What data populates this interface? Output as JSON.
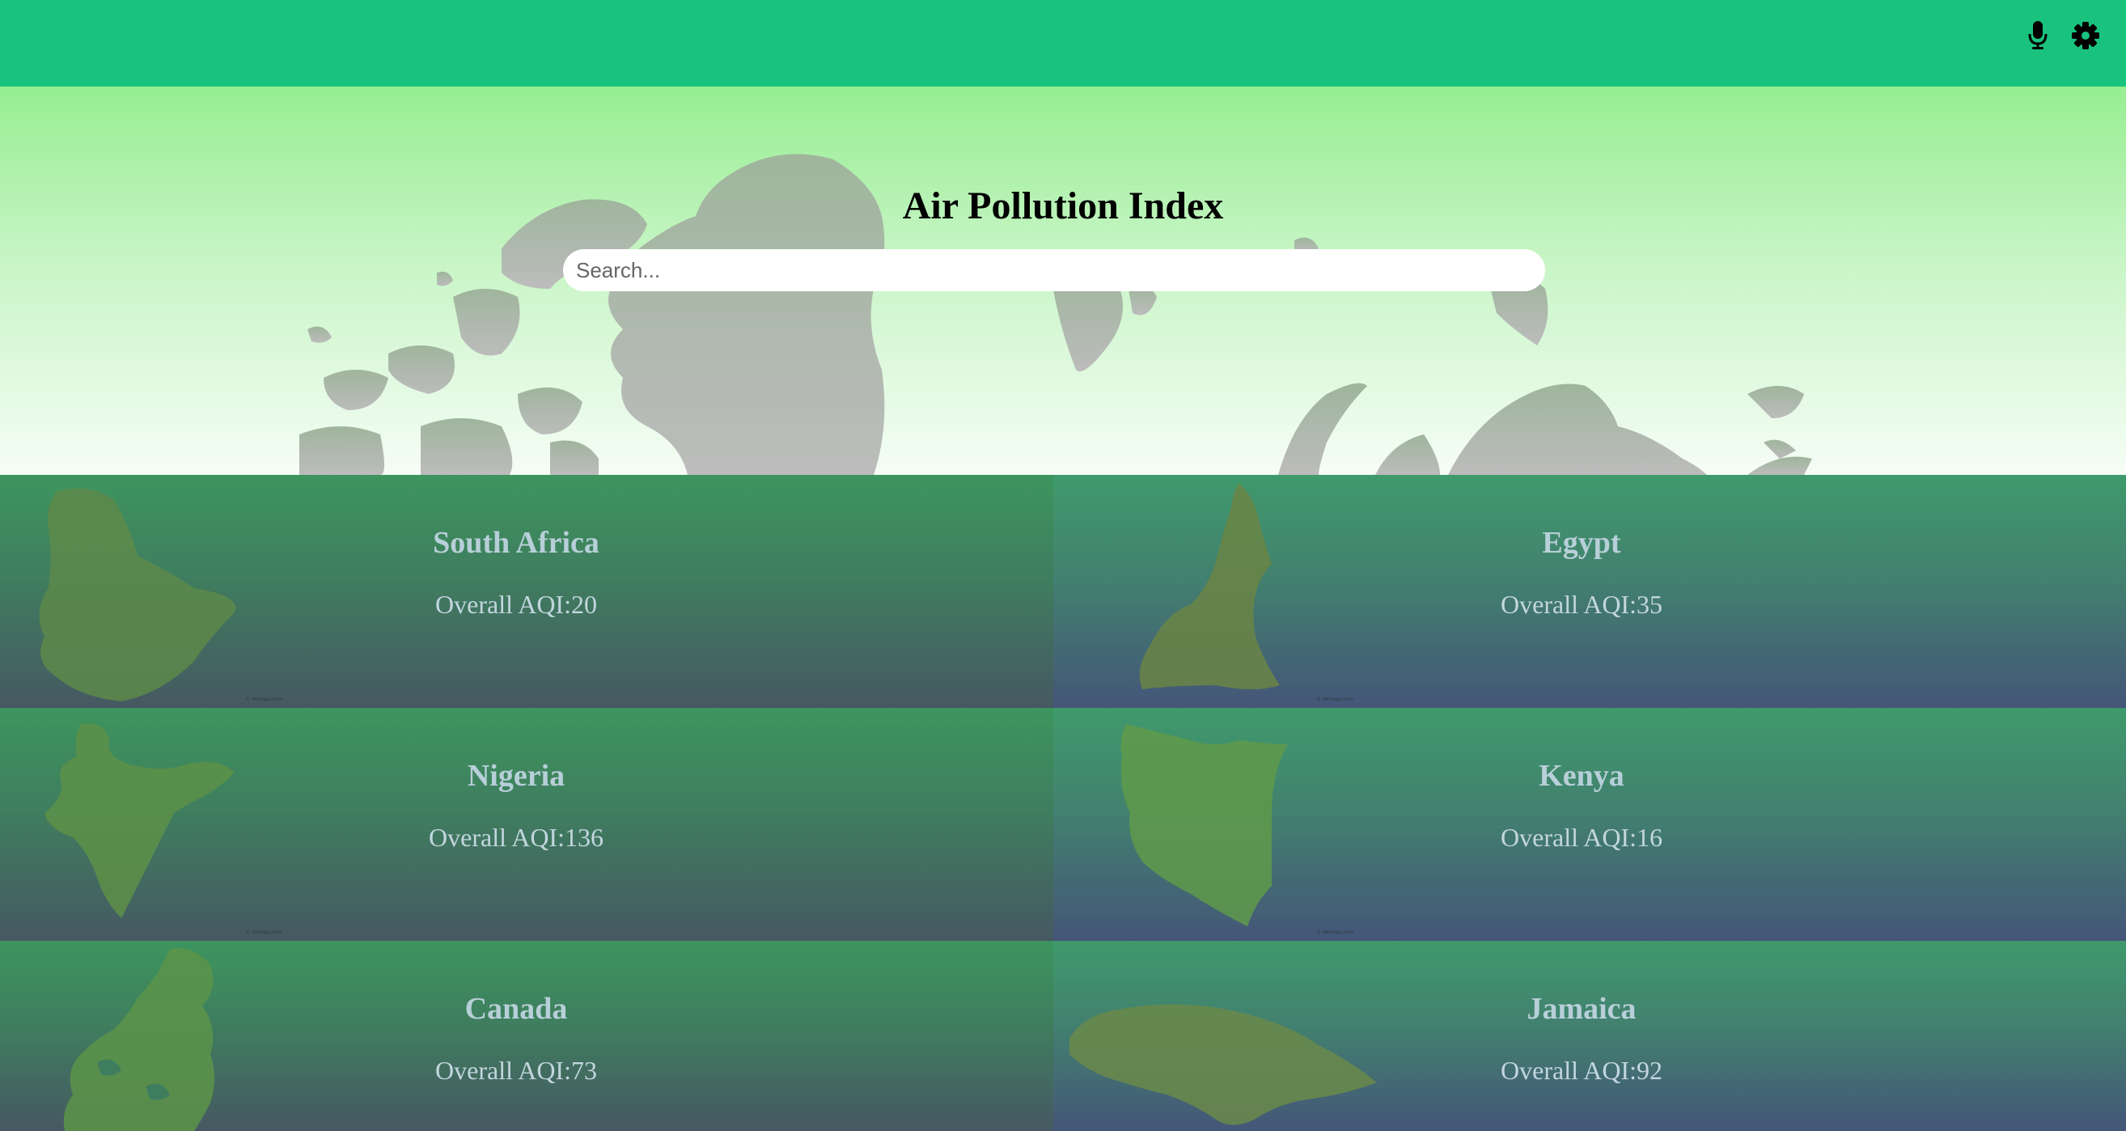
{
  "topbar": {
    "color": "#19c37d",
    "icons": [
      "microphone-icon",
      "gear-icon"
    ]
  },
  "hero": {
    "title": "Air Pollution Index",
    "search_placeholder": "Search...",
    "search_value": ""
  },
  "cards": [
    {
      "country": "South Africa",
      "aqi_label": "Overall AQI:",
      "aqi_value": "20"
    },
    {
      "country": "Egypt",
      "aqi_label": "Overall AQI:",
      "aqi_value": "35"
    },
    {
      "country": "Nigeria",
      "aqi_label": "Overall AQI:",
      "aqi_value": "136"
    },
    {
      "country": "Kenya",
      "aqi_label": "Overall AQI:",
      "aqi_value": "16"
    },
    {
      "country": "Canada",
      "aqi_label": "Overall AQI:",
      "aqi_value": "73"
    },
    {
      "country": "Jamaica",
      "aqi_label": "Overall AQI:",
      "aqi_value": "92"
    }
  ]
}
